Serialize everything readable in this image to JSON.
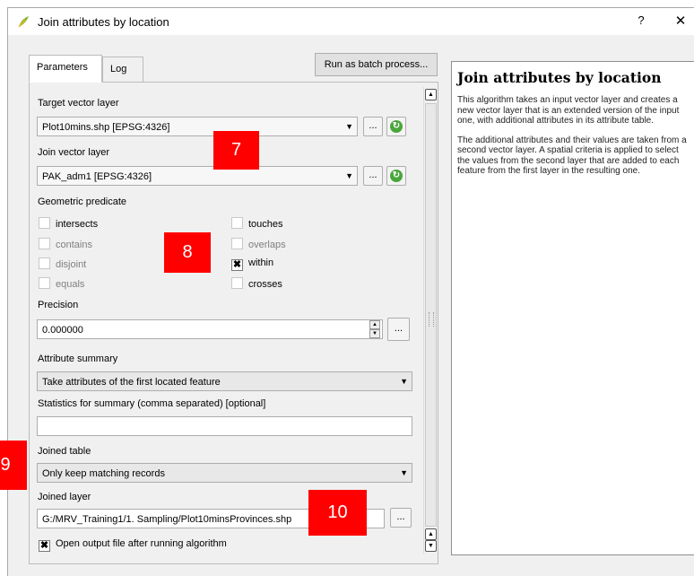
{
  "window": {
    "title": "Join attributes by location",
    "help_label": "?",
    "close_label": "✕"
  },
  "tabs": [
    {
      "label": "Parameters",
      "active": true
    },
    {
      "label": "Log",
      "active": false
    }
  ],
  "batch_button": "Run as batch process...",
  "target": {
    "label": "Target vector layer",
    "value": "Plot10mins.shp [EPSG:4326]"
  },
  "join": {
    "label": "Join vector layer",
    "value": "PAK_adm1 [EPSG:4326]"
  },
  "ellipsis": "...",
  "predicate": {
    "label": "Geometric predicate",
    "options": [
      {
        "label": "intersects",
        "checked": false
      },
      {
        "label": "contains",
        "checked": false
      },
      {
        "label": "disjoint",
        "checked": false
      },
      {
        "label": "equals",
        "checked": false
      },
      {
        "label": "touches",
        "checked": false
      },
      {
        "label": "overlaps",
        "checked": false
      },
      {
        "label": "within",
        "checked": true
      },
      {
        "label": "crosses",
        "checked": false
      }
    ]
  },
  "precision": {
    "label": "Precision",
    "value": "0.000000"
  },
  "summary": {
    "label": "Attribute summary",
    "value": "Take attributes of the first located feature"
  },
  "statistics": {
    "label": "Statistics for summary (comma separated) [optional]",
    "value": ""
  },
  "joined_table": {
    "label": "Joined table",
    "value": "Only keep matching records"
  },
  "joined_layer": {
    "label": "Joined layer",
    "value": "G:/MRV_Training1/1. Sampling/Plot10minsProvinces.shp"
  },
  "open_output": {
    "label": "Open output file after running algorithm",
    "checked": true
  },
  "help": {
    "title": "Join attributes by location",
    "paragraphs": [
      "This algorithm takes an input vector layer and creates a new vector layer that is an extended version of the input one, with additional attributes in its attribute table.",
      "The additional attributes and their values are taken from a second vector layer. A spatial criteria is applied to select the values from the second layer that are added to each feature from the first layer in the resulting one."
    ]
  },
  "badges": [
    "7",
    "8",
    "9",
    "10"
  ],
  "colors": {
    "badge": "#ff0000",
    "refresh": "#4aa63c",
    "dialog_bg": "#f0f0f0"
  }
}
